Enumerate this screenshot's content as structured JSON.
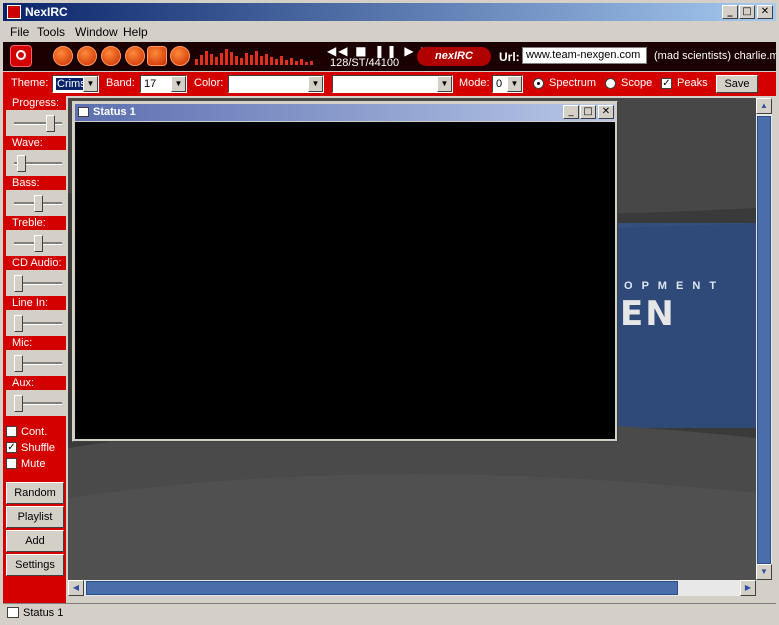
{
  "app": {
    "title": "NexIRC"
  },
  "menu": [
    "File",
    "Tools",
    "Window",
    "Help"
  ],
  "player": {
    "transport_symbols": "◀◀ ■ ❚❚ ▶ ▶▶",
    "bitrate": "128/ST/44100",
    "logo": "nexIRC",
    "url_label": "Url:",
    "url_value": "www.team-nexgen.com",
    "channel_text": "(mad scientists) charlie.m"
  },
  "options": {
    "theme_label": "Theme:",
    "theme_value": "Crims",
    "band_label": "Band:",
    "band_value": "17",
    "color_label": "Color:",
    "color_value": "",
    "color2_value": "",
    "mode_label": "Mode:",
    "mode_value": "0",
    "spectrum_label": "Spectrum",
    "scope_label": "Scope",
    "peaks_label": "Peaks",
    "save_label": "Save"
  },
  "sliders": [
    {
      "label": "Progress:",
      "level": 0.78
    },
    {
      "label": "Wave:",
      "level": 0.12
    },
    {
      "label": "Bass:",
      "level": 0.5
    },
    {
      "label": "Treble:",
      "level": 0.5
    },
    {
      "label": "CD Audio:",
      "level": 0.05
    },
    {
      "label": "Line In:",
      "level": 0.05
    },
    {
      "label": "Mic:",
      "level": 0.05
    },
    {
      "label": "Aux:",
      "level": 0.05
    }
  ],
  "checks": [
    {
      "label": "Cont.",
      "checked": false
    },
    {
      "label": "Shuffle",
      "checked": true
    },
    {
      "label": "Mute",
      "checked": false
    }
  ],
  "buttons": [
    "Random",
    "Playlist",
    "Add",
    "Settings"
  ],
  "child_window": {
    "title": "Status 1"
  },
  "background_art": {
    "word1": "O P M E N T",
    "word2": "EN"
  },
  "statusbar": {
    "text": "Status 1"
  },
  "colors": {
    "accent": "#d40000",
    "titlebar": "#0a246a",
    "desktop": "#3c3c3c"
  }
}
